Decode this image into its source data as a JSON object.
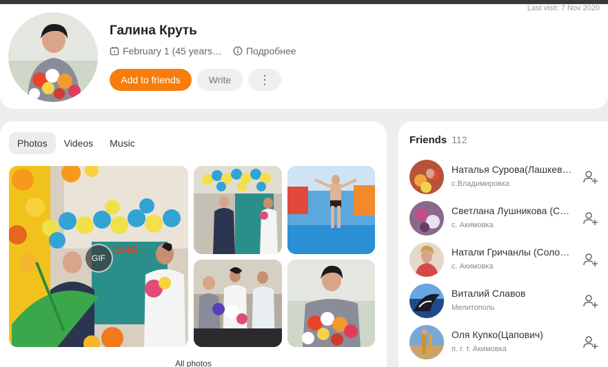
{
  "profile": {
    "last_visit": "Last visit: 7 Nov 2020",
    "name": "Галина Круть",
    "birthday": "February 1 (45 years…",
    "more_info": "Подробнее",
    "add_friend_label": "Add to friends",
    "write_label": "Write",
    "more_label": "⋮"
  },
  "media": {
    "tabs": [
      {
        "label": "Photos",
        "active": true
      },
      {
        "label": "Videos",
        "active": false
      },
      {
        "label": "Music",
        "active": false
      }
    ],
    "gif_badge": "GIF",
    "all_photos_label": "All photos"
  },
  "friends": {
    "title": "Friends",
    "count": "112",
    "items": [
      {
        "name": "Наталья Сурова(Лашкев…",
        "location": "с.Владимировка"
      },
      {
        "name": "Светлана Лушникова (С…",
        "location": "с. Акимовка"
      },
      {
        "name": "Натали Гричанлы (Соло…",
        "location": "с. Акимовка"
      },
      {
        "name": "Виталий Славов",
        "location": "Мелитополь"
      },
      {
        "name": "Оля Купко(Цапович)",
        "location": "п. г. т. Акимовка"
      }
    ]
  },
  "colors": {
    "accent": "#f77d0c",
    "background": "#eeeeee",
    "card": "#ffffff"
  },
  "icons": [
    "calendar-icon",
    "info-icon",
    "kebab-menu-icon",
    "add-friend-icon"
  ]
}
